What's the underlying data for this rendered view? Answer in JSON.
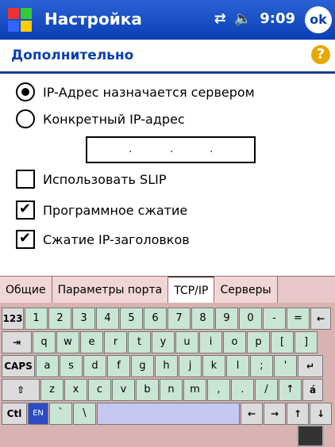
{
  "titlebar": {
    "app_title": "Настройка",
    "time": "9:09",
    "ok_label": "ok"
  },
  "page": {
    "header": "Дополнительно",
    "help_label": "?"
  },
  "options": {
    "radio_server": "IP-Адрес назначается сервером",
    "radio_specific": "Конкретный IP-адрес",
    "ip_dots": [
      ".",
      ".",
      "."
    ],
    "use_slip": "Использовать SLIP",
    "soft_compression": "Программное сжатие",
    "header_compression": "Сжатие IP-заголовков"
  },
  "tabs": [
    "Общие",
    "Параметры порта",
    "TCP/IP",
    "Серверы"
  ],
  "keyboard": {
    "row1": [
      "123",
      "1",
      "2",
      "3",
      "4",
      "5",
      "6",
      "7",
      "8",
      "9",
      "0",
      "-",
      "=",
      "←"
    ],
    "row2": [
      "⇥",
      "q",
      "w",
      "e",
      "r",
      "t",
      "y",
      "u",
      "i",
      "o",
      "p",
      "[",
      "]"
    ],
    "row3": [
      "CAPS",
      "a",
      "s",
      "d",
      "f",
      "g",
      "h",
      "j",
      "k",
      "l",
      ";",
      "'",
      "↵"
    ],
    "row4": [
      "⇧",
      "z",
      "x",
      "c",
      "v",
      "b",
      "n",
      "m",
      ",",
      ".",
      "/",
      "↑",
      "á"
    ],
    "row5": [
      "Ctl",
      "EN",
      "`",
      "\\",
      "",
      "←",
      "→",
      "↑",
      "↓"
    ]
  }
}
